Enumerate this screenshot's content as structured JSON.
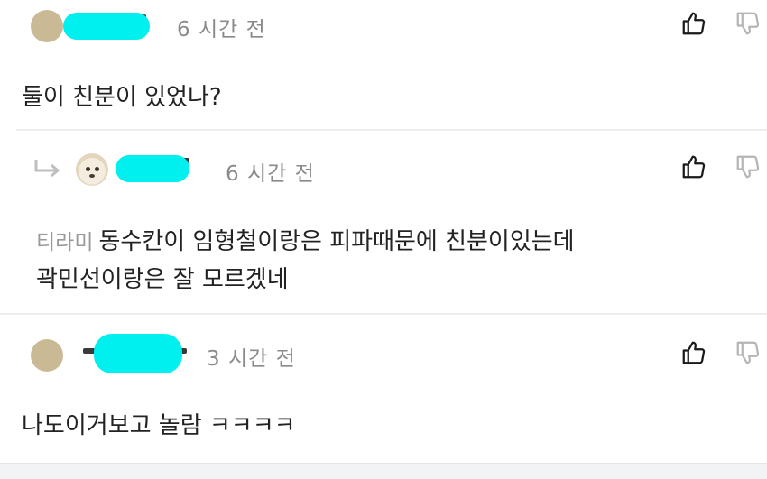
{
  "comments": [
    {
      "time": "6 시간 전",
      "body": "둘이 친분이 있었나?"
    },
    {
      "time": "6 시간 전",
      "mention": "티라미",
      "body_line1": "동수칸이 임형철이랑은 피파때문에 친분이있는데",
      "body_line2": "곽민선이랑은 잘 모르겠네"
    },
    {
      "time": "3 시간 전",
      "body": "나도이거보고 놀람 ㅋㅋㅋㅋ"
    }
  ],
  "icons": {
    "like": "thumbs-up-icon",
    "dislike": "thumbs-down-icon",
    "reply": "reply-arrow-icon"
  }
}
